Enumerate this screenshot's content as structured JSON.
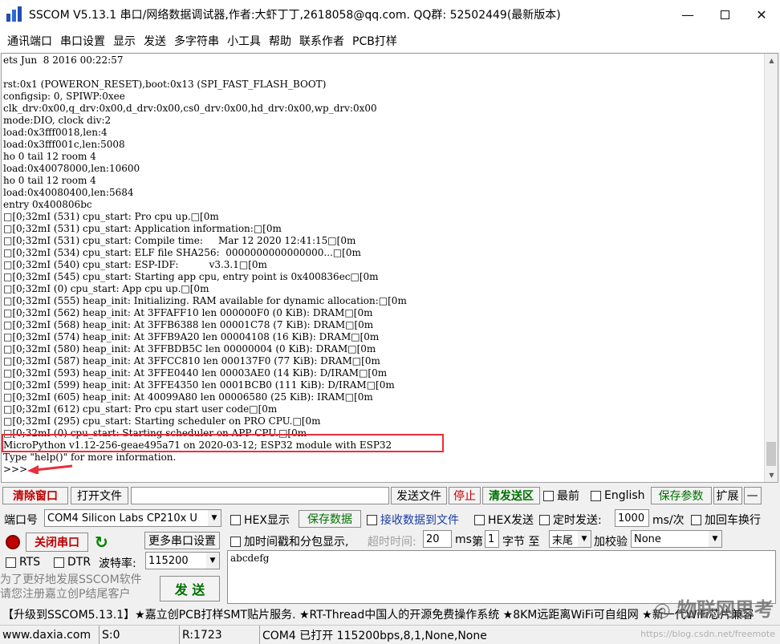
{
  "window": {
    "title": "SSCOM V5.13.1 串口/网络数据调试器,作者:大虾丁丁,2618058@qq.com. QQ群: 52502449(最新版本)",
    "minimize": "—",
    "close": "✕"
  },
  "menu": [
    "通讯端口",
    "串口设置",
    "显示",
    "发送",
    "多字符串",
    "小工具",
    "帮助",
    "联系作者",
    "PCB打样"
  ],
  "terminal": {
    "lines": [
      "ets Jun  8 2016 00:22:57",
      "",
      "rst:0x1 (POWERON_RESET),boot:0x13 (SPI_FAST_FLASH_BOOT)",
      "configsip: 0, SPIWP:0xee",
      "clk_drv:0x00,q_drv:0x00,d_drv:0x00,cs0_drv:0x00,hd_drv:0x00,wp_drv:0x00",
      "mode:DIO, clock div:2",
      "load:0x3fff0018,len:4",
      "load:0x3fff001c,len:5008",
      "ho 0 tail 12 room 4",
      "load:0x40078000,len:10600",
      "ho 0 tail 12 room 4",
      "load:0x40080400,len:5684",
      "entry 0x400806bc",
      "□[0;32mI (531) cpu_start: Pro cpu up.□[0m",
      "□[0;32mI (531) cpu_start: Application information:□[0m",
      "□[0;32mI (531) cpu_start: Compile time:     Mar 12 2020 12:41:15□[0m",
      "□[0;32mI (534) cpu_start: ELF file SHA256:  0000000000000000...□[0m",
      "□[0;32mI (540) cpu_start: ESP-IDF:          v3.3.1□[0m",
      "□[0;32mI (545) cpu_start: Starting app cpu, entry point is 0x400836ec□[0m",
      "□[0;32mI (0) cpu_start: App cpu up.□[0m",
      "□[0;32mI (555) heap_init: Initializing. RAM available for dynamic allocation:□[0m",
      "□[0;32mI (562) heap_init: At 3FFAFF10 len 000000F0 (0 KiB): DRAM□[0m",
      "□[0;32mI (568) heap_init: At 3FFB6388 len 00001C78 (7 KiB): DRAM□[0m",
      "□[0;32mI (574) heap_init: At 3FFB9A20 len 00004108 (16 KiB): DRAM□[0m",
      "□[0;32mI (580) heap_init: At 3FFBDB5C len 00000004 (0 KiB): DRAM□[0m",
      "□[0;32mI (587) heap_init: At 3FFCC810 len 000137F0 (77 KiB): DRAM□[0m",
      "□[0;32mI (593) heap_init: At 3FFE0440 len 00003AE0 (14 KiB): D/IRAM□[0m",
      "□[0;32mI (599) heap_init: At 3FFE4350 len 0001BCB0 (111 KiB): D/IRAM□[0m",
      "□[0;32mI (605) heap_init: At 40099A80 len 00006580 (25 KiB): IRAM□[0m",
      "□[0;32mI (612) cpu_start: Pro cpu start user code□[0m",
      "□[0;32mI (295) cpu_start: Starting scheduler on PRO CPU.□[0m",
      "□[0;32mI (0) cpu_start: Starting scheduler on APP CPU.□[0m",
      "MicroPython v1.12-256-geae495a71 on 2020-03-12; ESP32 module with ESP32",
      "Type \"help()\" for more information.",
      ">>>"
    ]
  },
  "toolbar": {
    "clear": "清除窗口",
    "open_file": "打开文件",
    "send_file": "发送文件",
    "stop": "停止",
    "clear_send": "清发送区",
    "topmost": "最前",
    "english": "English",
    "save_params": "保存参数",
    "expand": "扩展",
    "collapse": "—"
  },
  "config": {
    "port_label": "端口号",
    "port_value": "COM4 Silicon Labs CP210x U",
    "hex_display": "HEX显示",
    "save_data": "保存数据",
    "recv_to_file": "接收数据到文件",
    "hex_send": "HEX发送",
    "timed_send": "定时发送:",
    "interval": "1000",
    "interval_unit": "ms/次",
    "add_crlf": "加回车换行",
    "close_port": "关闭串口",
    "more_settings": "更多串口设置",
    "timestamp": "加时间戳和分包显示,",
    "timeout_label": "超时时间:",
    "timeout": "20",
    "timeout_unit": "ms",
    "byte_prefix": "第",
    "byte_index": "1",
    "byte_suffix": "字节 至",
    "byte_end": "末尾",
    "checksum_label": "加校验",
    "checksum": "None",
    "rts": "RTS",
    "dtr": "DTR",
    "baud_label": "波特率:",
    "baud": "115200",
    "send_text": "abcdefg",
    "send_button": "发 送",
    "promo_line1": "为了更好地发展SSCOM软件",
    "promo_line2": "请您注册嘉立创P结尾客户"
  },
  "news": "【升级到SSCOM5.13.1】★嘉立创PCB打样SMT贴片服务. ★RT-Thread中国人的开源免费操作系统 ★8KM远距离WiFi可自组网 ★新一代WiFi芯片兼容",
  "status": {
    "site": "www.daxia.com",
    "sent": "S:0",
    "received": "R:1723",
    "port_status": "COM4 已打开  115200bps,8,1,None,None"
  },
  "watermark": {
    "name": "物联网思考",
    "url": "https://blog.csdn.net/freemote"
  },
  "colors": {
    "highlight": "#e8303a",
    "red_text": "#c00000",
    "green_text": "#007000"
  }
}
